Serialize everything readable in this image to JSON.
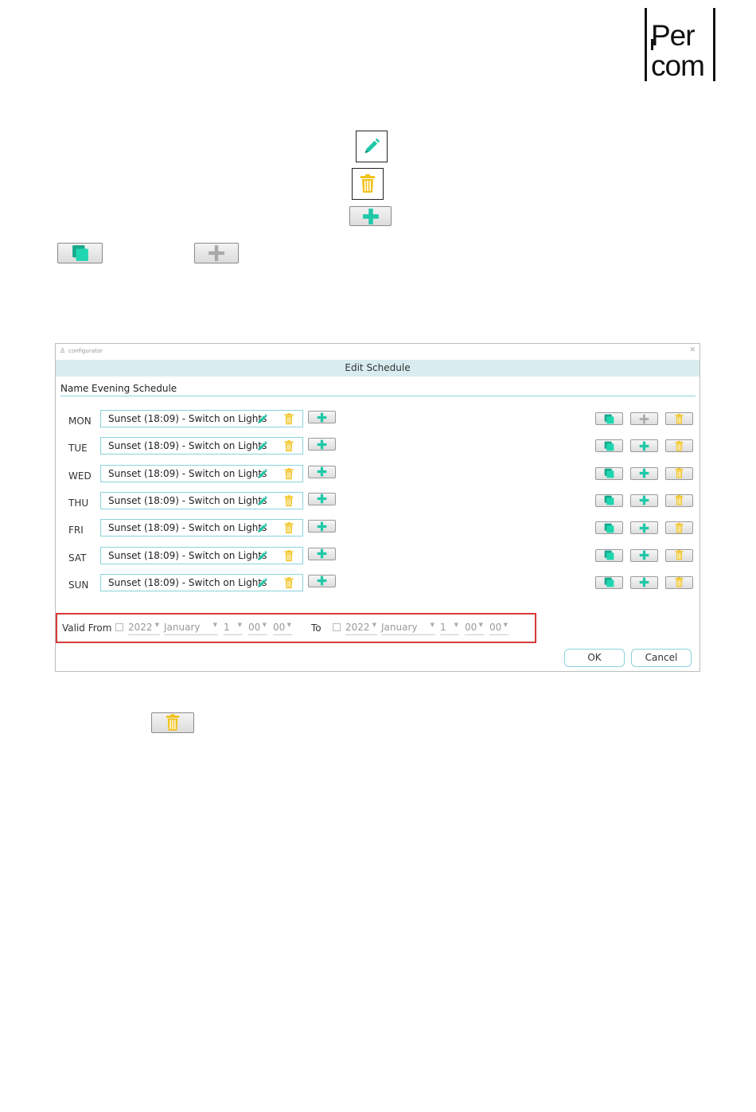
{
  "logo": {
    "line1": "Per",
    "line2": "com"
  },
  "dialog": {
    "app_title": "configurator",
    "header": "Edit Schedule",
    "name_label": "Name",
    "name_value": "Evening Schedule",
    "days": [
      {
        "day": "MON",
        "entry": "Sunset (18:09) - Switch on Lights"
      },
      {
        "day": "TUE",
        "entry": "Sunset (18:09) - Switch on Lights"
      },
      {
        "day": "WED",
        "entry": "Sunset (18:09) - Switch on Lights"
      },
      {
        "day": "THU",
        "entry": "Sunset (18:09) - Switch on Lights"
      },
      {
        "day": "FRI",
        "entry": "Sunset (18:09) - Switch on Lights"
      },
      {
        "day": "SAT",
        "entry": "Sunset (18:09) - Switch on Lights"
      },
      {
        "day": "SUN",
        "entry": "Sunset (18:09) - Switch on Lights"
      }
    ],
    "valid": {
      "from_label": "Valid From",
      "to_label": "To",
      "from": {
        "year": "2022",
        "month": "January",
        "day": "1",
        "hour": "00",
        "minute": "00"
      },
      "to": {
        "year": "2022",
        "month": "January",
        "day": "1",
        "hour": "00",
        "minute": "00"
      }
    },
    "ok_label": "OK",
    "cancel_label": "Cancel"
  },
  "colors": {
    "teal": "#1fc8a8",
    "yellow": "#f2c21b",
    "gray": "#a0a0a0",
    "accent_border": "#8ad3dc",
    "highlight": "#d63a3a"
  }
}
